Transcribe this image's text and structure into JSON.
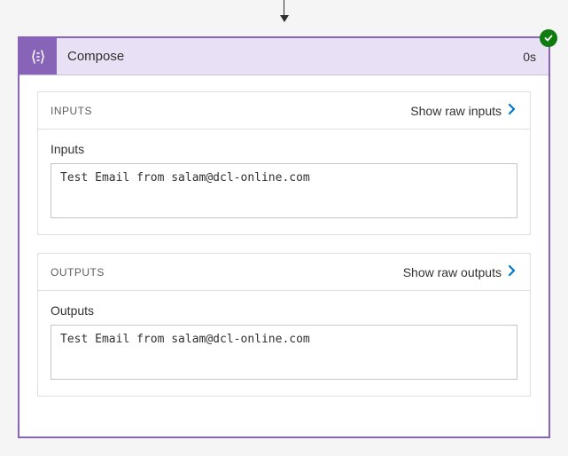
{
  "action": {
    "title": "Compose",
    "duration": "0s",
    "status": "success"
  },
  "inputs": {
    "section_label": "INPUTS",
    "show_raw_label": "Show raw inputs",
    "field_label": "Inputs",
    "value": "Test Email from salam@dcl-online.com"
  },
  "outputs": {
    "section_label": "OUTPUTS",
    "show_raw_label": "Show raw outputs",
    "field_label": "Outputs",
    "value": "Test Email from salam@dcl-online.com"
  }
}
